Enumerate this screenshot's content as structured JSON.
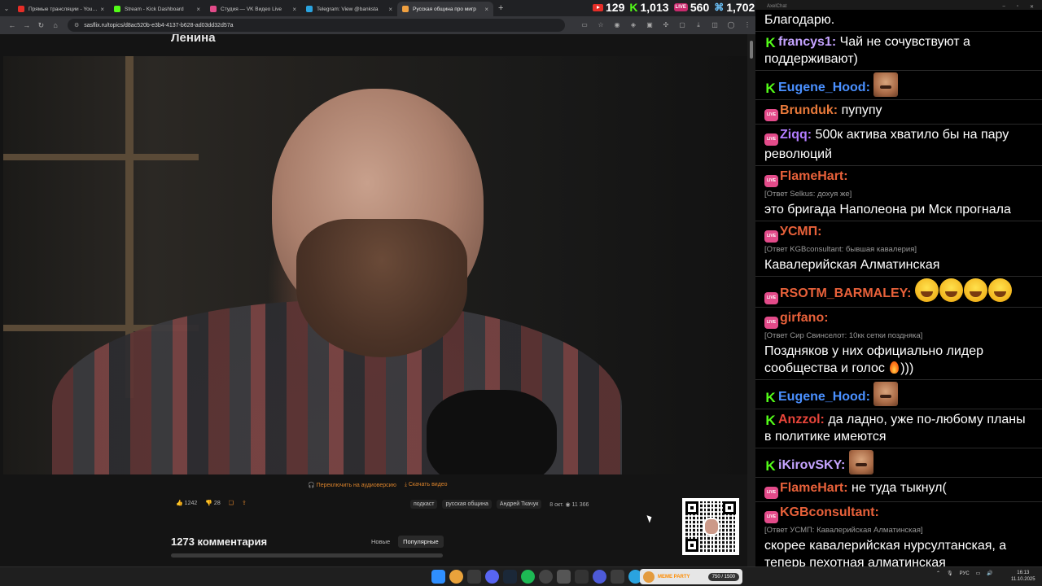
{
  "browser": {
    "tabs": [
      {
        "label": "Прямые трансляции - YouTube",
        "color": "#e52d27",
        "active": false
      },
      {
        "label": "Stream - Kick Dashboard",
        "color": "#53fc18",
        "active": false
      },
      {
        "label": "Студия — VK Видео Live",
        "color": "#e34b8a",
        "active": false
      },
      {
        "label": "Telegram: View @banksta",
        "color": "#2aa3df",
        "active": false
      },
      {
        "label": "Русская община про мигр",
        "color": "#f0a040",
        "active": true
      }
    ],
    "url": "sasflix.ru/topics/d8ac520b-e3b4-4137-b628-ad03dd32d57a"
  },
  "counters": {
    "youtube": "129",
    "kick": "1,013",
    "vk": "560",
    "other": "1,702",
    "live_badge": "LIVE"
  },
  "page": {
    "title": "Ленина",
    "switch_audio": "Переключить на аудиоверсию",
    "download_video": "Скачать видео",
    "likes": "1242",
    "dislikes": "28",
    "tags": [
      "подкаст",
      "русская община",
      "Андрей Ткачук"
    ],
    "date": "8 окт.",
    "views": "11 366",
    "comments_title": "1273 комментария",
    "sort_new": "Новые",
    "sort_popular": "Популярные"
  },
  "chat": {
    "window_title": "AxelChat",
    "messages": [
      {
        "platform": "none",
        "user": "",
        "user_color": "#ffffff",
        "reply": "",
        "text": "Благодарю.",
        "emote": ""
      },
      {
        "platform": "kick",
        "user": "francys1:",
        "user_color": "#c5a3ff",
        "reply": "",
        "text": "Чай не сочувствуют а поддерживают)",
        "emote": ""
      },
      {
        "platform": "kick",
        "user": "Eugene_Hood:",
        "user_color": "#4a90ff",
        "reply": "",
        "text": "",
        "emote": "face"
      },
      {
        "platform": "vk",
        "user": "Brunduk:",
        "user_color": "#e8793a",
        "reply": "",
        "text": "пупупу",
        "emote": ""
      },
      {
        "platform": "vk",
        "user": "Ziqq:",
        "user_color": "#b37dff",
        "reply": "",
        "text": "500к актива хватило бы на пару революций",
        "emote": ""
      },
      {
        "platform": "vk",
        "user": "FlameHart:",
        "user_color": "#e8613a",
        "reply": "[Ответ Selkus: дохуя же]",
        "text": "это бригада Наполеона ри Мск прогнала",
        "emote": ""
      },
      {
        "platform": "vk",
        "user": "УСМП:",
        "user_color": "#e8613a",
        "reply": "[Ответ KGBconsultant: бывшая кавалерия]",
        "text": "Кавалерийская Алматинская",
        "emote": ""
      },
      {
        "platform": "vk",
        "user": "RSOTM_BARMALEY:",
        "user_color": "#e8613a",
        "reply": "",
        "text": "",
        "emote": "laugh4"
      },
      {
        "platform": "vk",
        "user": "girfano:",
        "user_color": "#e8613a",
        "reply": "[Ответ Сир Свинселот: 10кк сетки поздняка]",
        "text": "Поздняков у них официально лидер сообщества и голос",
        "emote": "fire",
        "text_after": ")))"
      },
      {
        "platform": "kick",
        "user": "Eugene_Hood:",
        "user_color": "#4a90ff",
        "reply": "",
        "text": "",
        "emote": "face"
      },
      {
        "platform": "kick",
        "user": "Anzzol:",
        "user_color": "#e8453a",
        "reply": "",
        "text": "да ладно, уже по-любому планы в политике имеются",
        "emote": ""
      },
      {
        "platform": "kick",
        "user": "iKirovSKY:",
        "user_color": "#c5a3ff",
        "reply": "",
        "text": "",
        "emote": "face"
      },
      {
        "platform": "vk",
        "user": "FlameHart:",
        "user_color": "#e8613a",
        "reply": "",
        "text": "не туда тыкнул(",
        "emote": ""
      },
      {
        "platform": "vk",
        "user": "KGBconsultant:",
        "user_color": "#e8613a",
        "reply": "[Ответ УСМП: Кавалерийская Алматинская]",
        "text": "скорее кавалерийская нурсултанская, а теперь пехотная алматинская",
        "emote": ""
      }
    ]
  },
  "taskbar": {
    "meme_label": "MEME PARTY",
    "meme_count": "750 / 1500",
    "lang": "РУС",
    "time": "16:13",
    "date": "11.10.2025"
  }
}
